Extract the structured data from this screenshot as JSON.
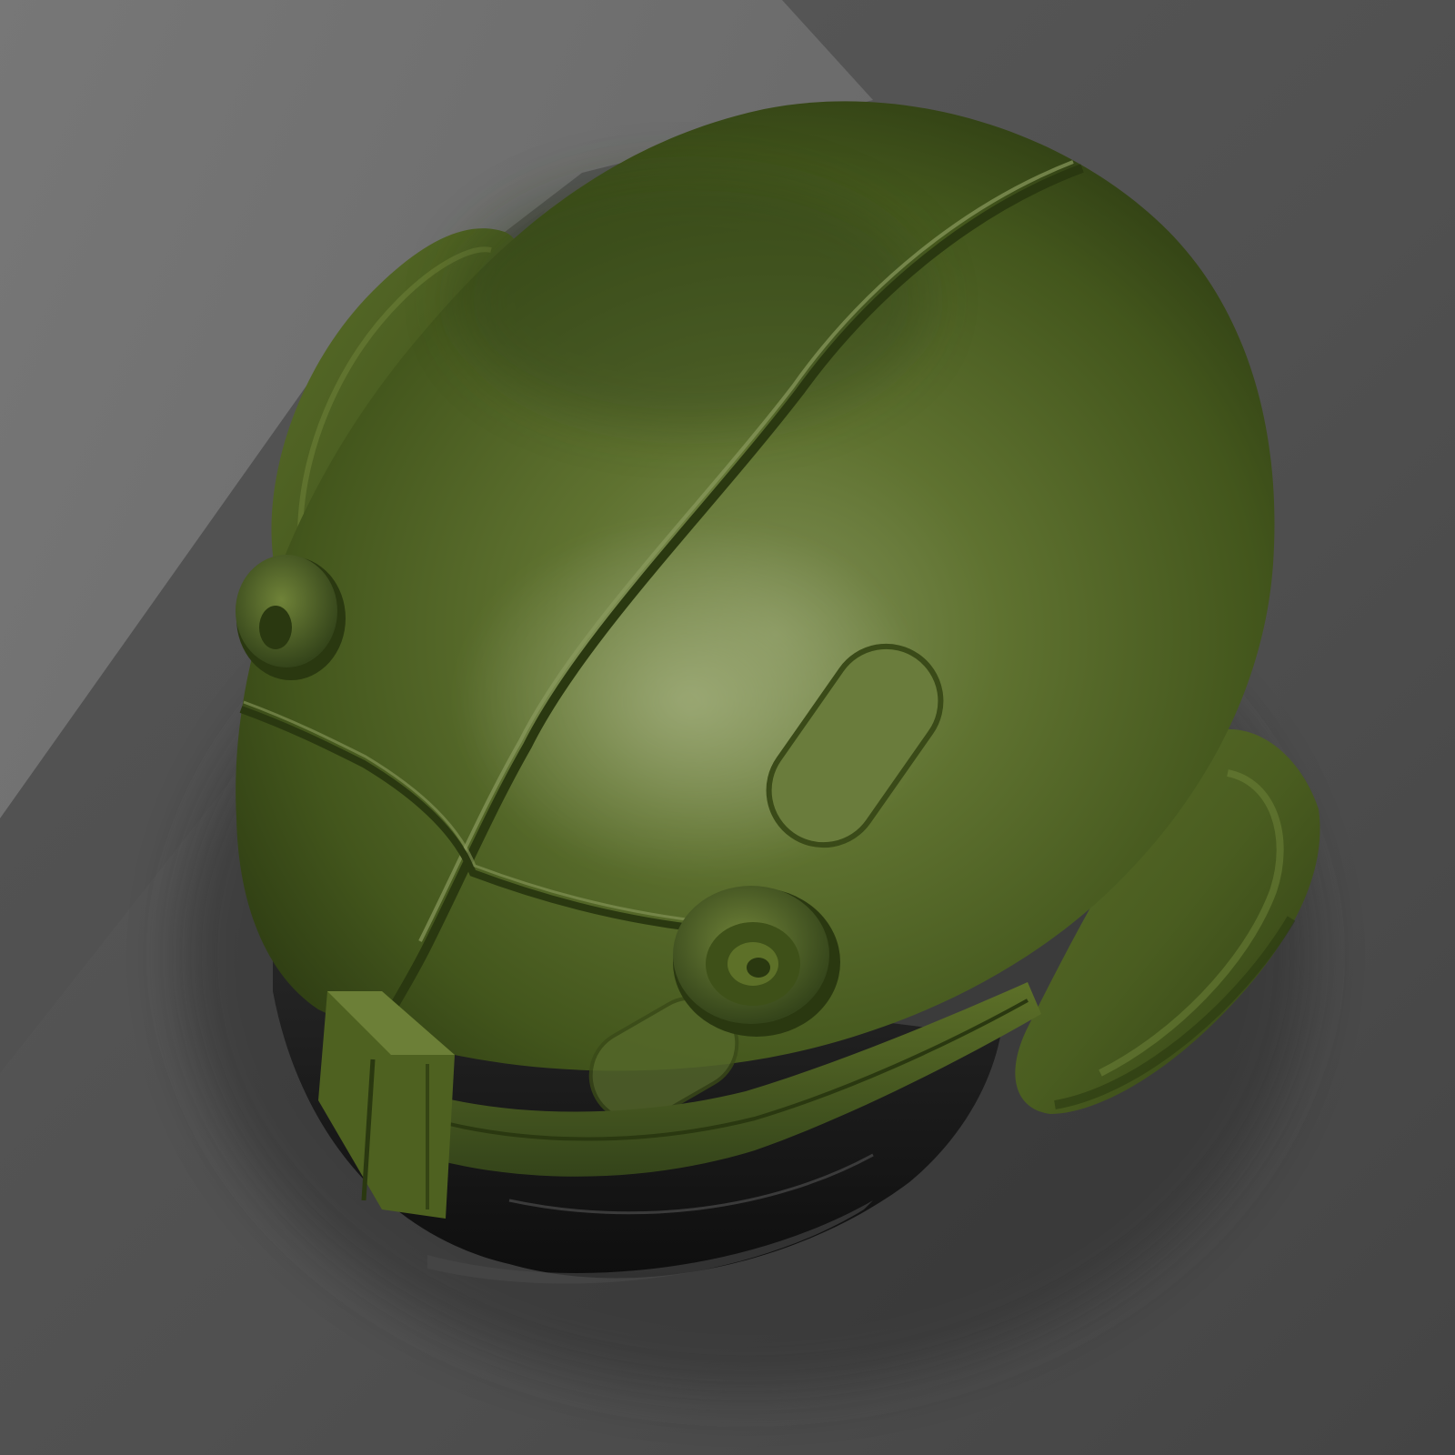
{
  "scene": {
    "subject": "helmet-render",
    "colors": {
      "background_light": "#6e6e6e",
      "background_mid": "#555555",
      "background_dark": "#3a3a3a",
      "shadow": "#2e2e2e",
      "shell_highlight": "#8a9a5e",
      "shell_mid": "#55682a",
      "shell_dark": "#2f3d14",
      "shell_edge": "#243010",
      "visor_black": "#141414",
      "visor_sheen": "#3a3a3a"
    }
  }
}
